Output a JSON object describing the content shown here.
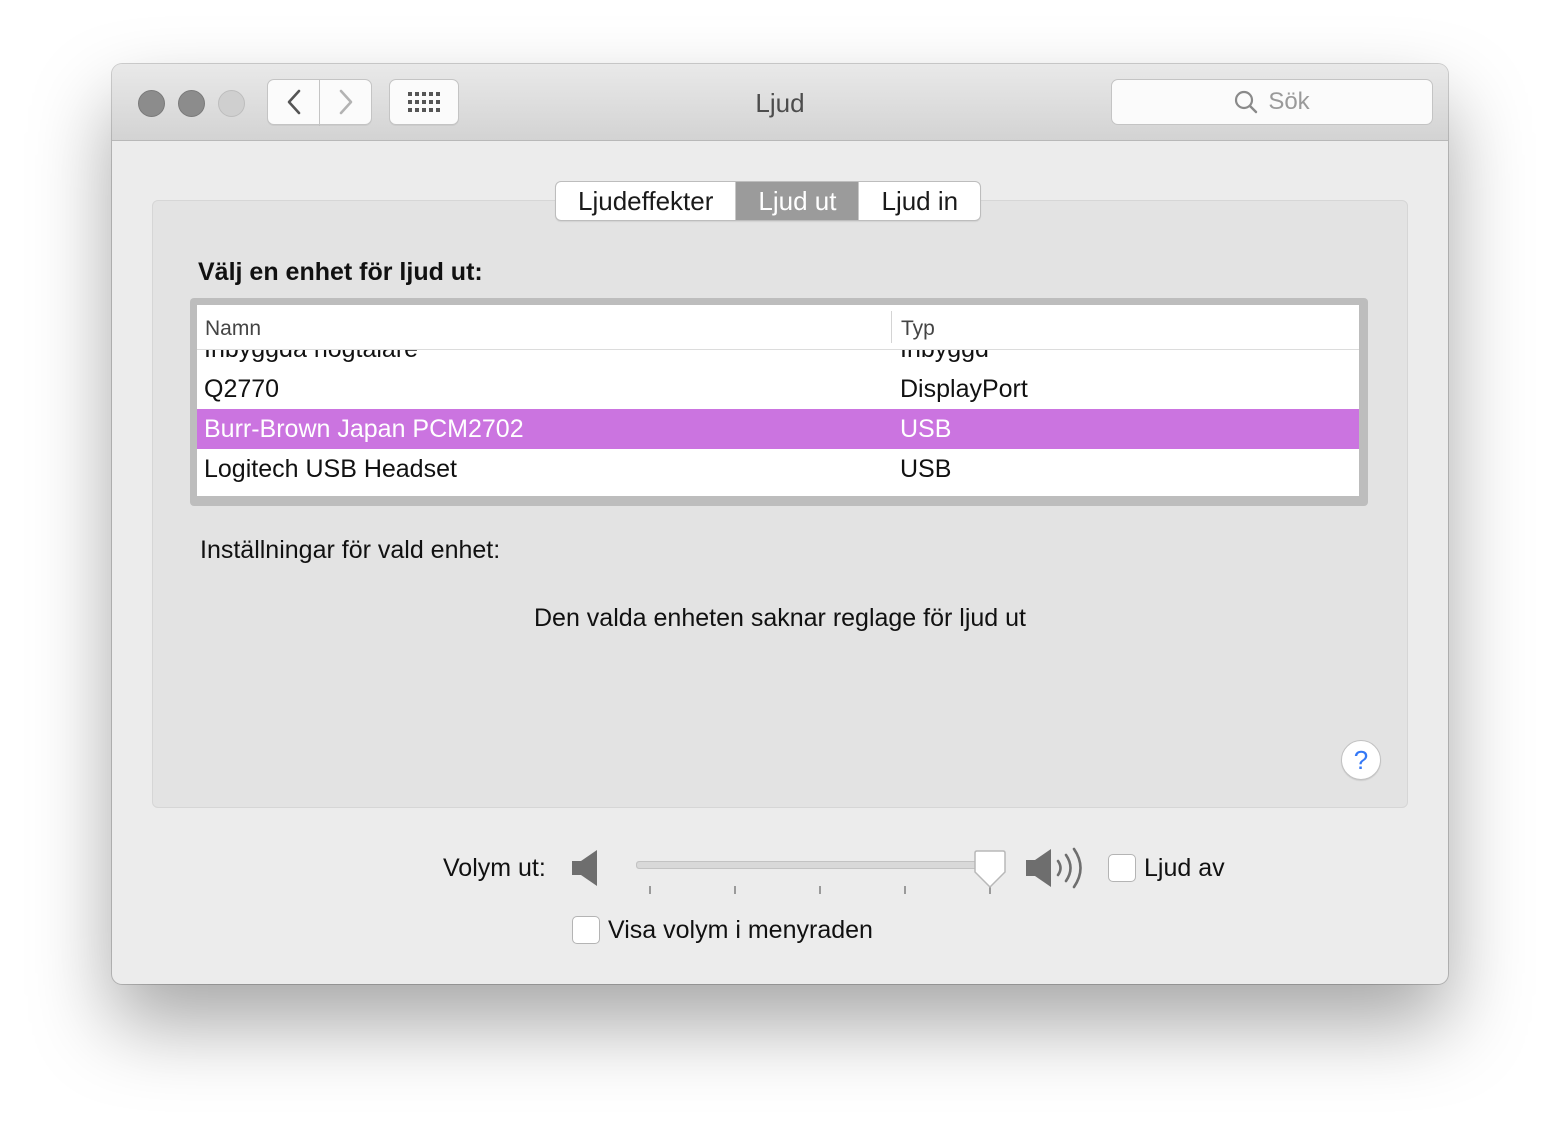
{
  "window": {
    "title": "Ljud"
  },
  "search": {
    "placeholder": "Sök"
  },
  "tabs": [
    {
      "label": "Ljudeffekter",
      "active": false
    },
    {
      "label": "Ljud ut",
      "active": true
    },
    {
      "label": "Ljud in",
      "active": false
    }
  ],
  "output": {
    "heading": "Välj en enhet för ljud ut:",
    "columns": {
      "name": "Namn",
      "type": "Typ"
    },
    "devices": [
      {
        "name": "Inbyggda högtalare",
        "type": "Inbyggd"
      },
      {
        "name": "Q2770",
        "type": "DisplayPort"
      },
      {
        "name": "Burr-Brown Japan PCM2702",
        "type": "USB"
      },
      {
        "name": "Logitech USB Headset",
        "type": "USB"
      }
    ],
    "selected_index": 2,
    "settings_label": "Inställningar för vald enhet:",
    "no_controls_message": "Den valda enheten saknar reglage för ljud ut"
  },
  "help": {
    "symbol": "?"
  },
  "volume": {
    "label": "Volym ut:",
    "level": 1.0,
    "mute_label": "Ljud av",
    "mute_checked": false,
    "show_in_menubar_label": "Visa volym i menyraden",
    "show_in_menubar_checked": false
  },
  "colors": {
    "selection": "#cb74e0",
    "help_accent": "#3478f6",
    "active_tab": "#9b9b9b"
  }
}
